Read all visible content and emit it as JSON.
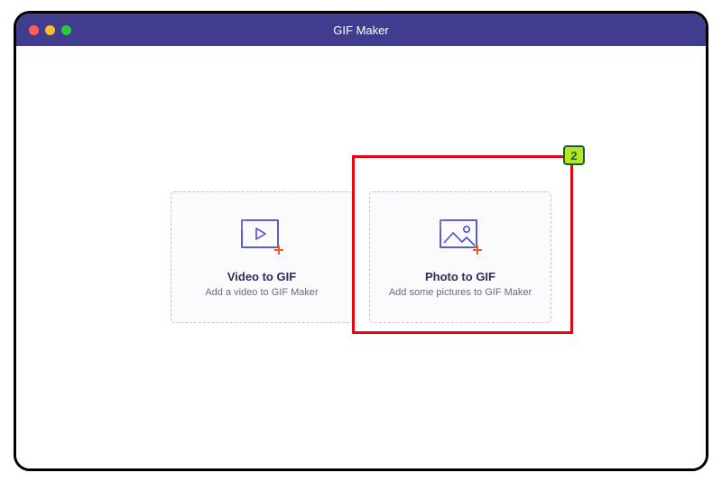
{
  "window": {
    "title": "GIF Maker"
  },
  "cards": {
    "video": {
      "title": "Video to GIF",
      "desc": "Add a video to GIF Maker"
    },
    "photo": {
      "title": "Photo to GIF",
      "desc": "Add some pictures to GIF Maker"
    }
  },
  "annotation": {
    "badge": "2"
  },
  "colors": {
    "titlebar": "#413D8E",
    "icon_stroke": "#4A4ED6",
    "plus": "#F15A24",
    "highlight": "#E30613",
    "badge_fill": "#B6E61D",
    "badge_border": "#13613B"
  }
}
